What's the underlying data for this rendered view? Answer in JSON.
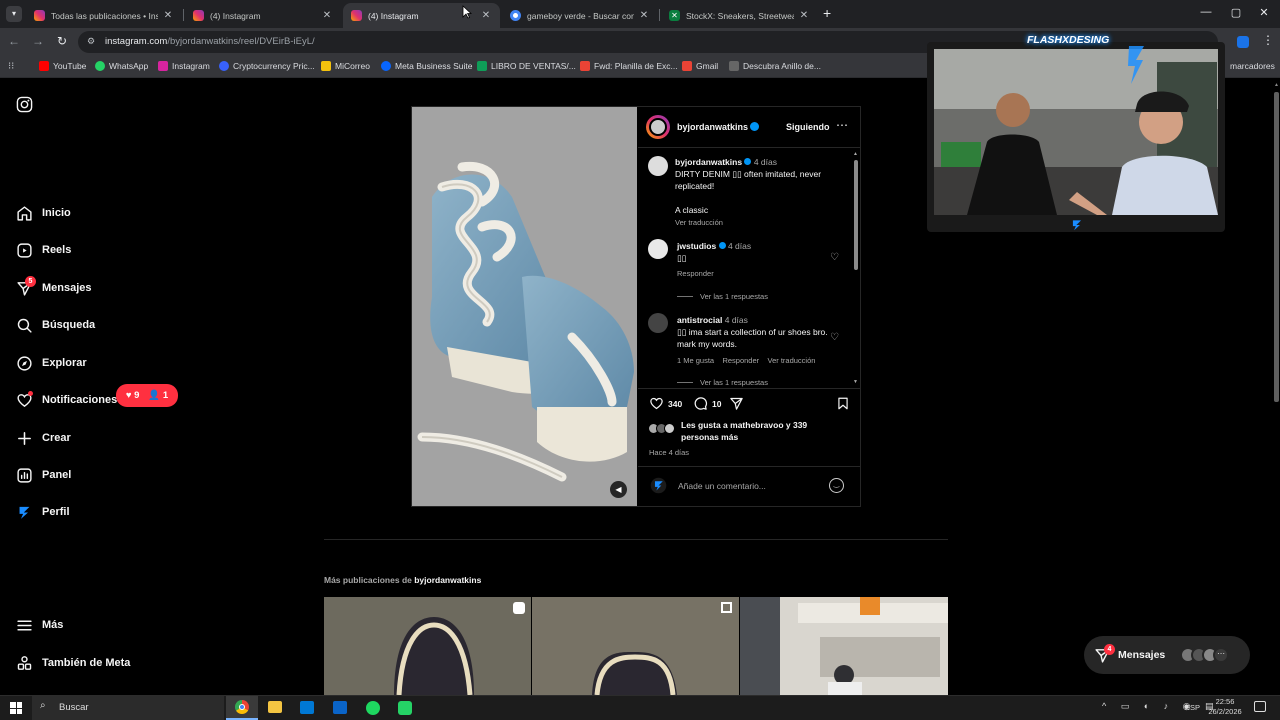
{
  "browser": {
    "tabs": [
      {
        "title": "Todas las publicaciones • Instag",
        "favicon": "instagram-icon"
      },
      {
        "title": "(4) Instagram",
        "favicon": "instagram-icon"
      },
      {
        "title": "(4) Instagram",
        "favicon": "instagram-icon",
        "active": true
      },
      {
        "title": "gameboy verde - Buscar con G",
        "favicon": "google-icon"
      },
      {
        "title": "StockX: Sneakers, Streetwear, T",
        "favicon": "stockx-icon"
      }
    ],
    "url_host": "instagram.com",
    "url_path": "/byjordanwatkins/reel/DVEirB-iEyL/",
    "bookmarks": [
      {
        "label": "YouTube",
        "color": "#ff0000"
      },
      {
        "label": "WhatsApp",
        "color": "#25d366"
      },
      {
        "label": "Instagram",
        "color": "#d6249f"
      },
      {
        "label": "Cryptocurrency Pric...",
        "color": "#3861fb"
      },
      {
        "label": "MiCorreo",
        "color": "#f4c20d"
      },
      {
        "label": "Meta Business Suite",
        "color": "#0866ff"
      },
      {
        "label": "LIBRO DE VENTAS/...",
        "color": "#0f9d58"
      },
      {
        "label": "Fwd: Planilla de Exc...",
        "color": "#ea4335"
      },
      {
        "label": "Gmail",
        "color": "#ea4335"
      },
      {
        "label": "Descubra Anillo de...",
        "color": "#666666"
      }
    ],
    "bookmarks_folder": "marcadores"
  },
  "sidebar": {
    "items": [
      {
        "label": "Inicio",
        "icon": "home-icon"
      },
      {
        "label": "Reels",
        "icon": "reels-icon"
      },
      {
        "label": "Mensajes",
        "icon": "messenger-icon",
        "badge": "5"
      },
      {
        "label": "Búsqueda",
        "icon": "search-icon"
      },
      {
        "label": "Explorar",
        "icon": "compass-icon"
      },
      {
        "label": "Notificaciones",
        "icon": "heart-icon"
      },
      {
        "label": "Crear",
        "icon": "plus-icon"
      },
      {
        "label": "Panel",
        "icon": "chart-icon"
      },
      {
        "label": "Perfil",
        "icon": "avatar"
      }
    ],
    "notif_likes": "9",
    "notif_follows": "1",
    "more_label": "Más",
    "meta_label": "También de Meta"
  },
  "post": {
    "username": "byjordanwatkins",
    "follow_label": "Siguiendo",
    "caption": {
      "username": "byjordanwatkins",
      "time": "4 días",
      "text": "DIRTY DENIM ▯▯ often imitated, never replicated!",
      "text2": "A classic",
      "translate": "Ver traducción"
    },
    "comments": [
      {
        "username": "jwstudios",
        "time": "4 días",
        "text": "▯▯",
        "reply": "Responder",
        "view_replies": "Ver las 1 respuestas"
      },
      {
        "username": "antistrocial",
        "time": "4 días",
        "text": "▯▯ ima start a collection of ur shoes bro. mark my words.",
        "likes": "1 Me gusta",
        "reply": "Responder",
        "translate": "Ver traducción",
        "view_replies": "Ver las 1 respuestas"
      }
    ],
    "likes_count": "340",
    "comments_count": "10",
    "liked_by_prefix": "Les gusta a ",
    "liked_by_user": "mathebravoo",
    "liked_by_suffix": " y 339 personas más",
    "posted": "Hace 4 días",
    "comment_placeholder": "Añade un comentario..."
  },
  "more_posts": {
    "label_prefix": "Más publicaciones de ",
    "label_user": "byjordanwatkins"
  },
  "overlay": {
    "brand": "FLASHXDESING"
  },
  "messages_pill": {
    "label": "Mensajes",
    "badge": "4"
  },
  "taskbar": {
    "search": "Buscar",
    "lang": "ESP",
    "time": "22:56",
    "date": "26/2/2026"
  }
}
